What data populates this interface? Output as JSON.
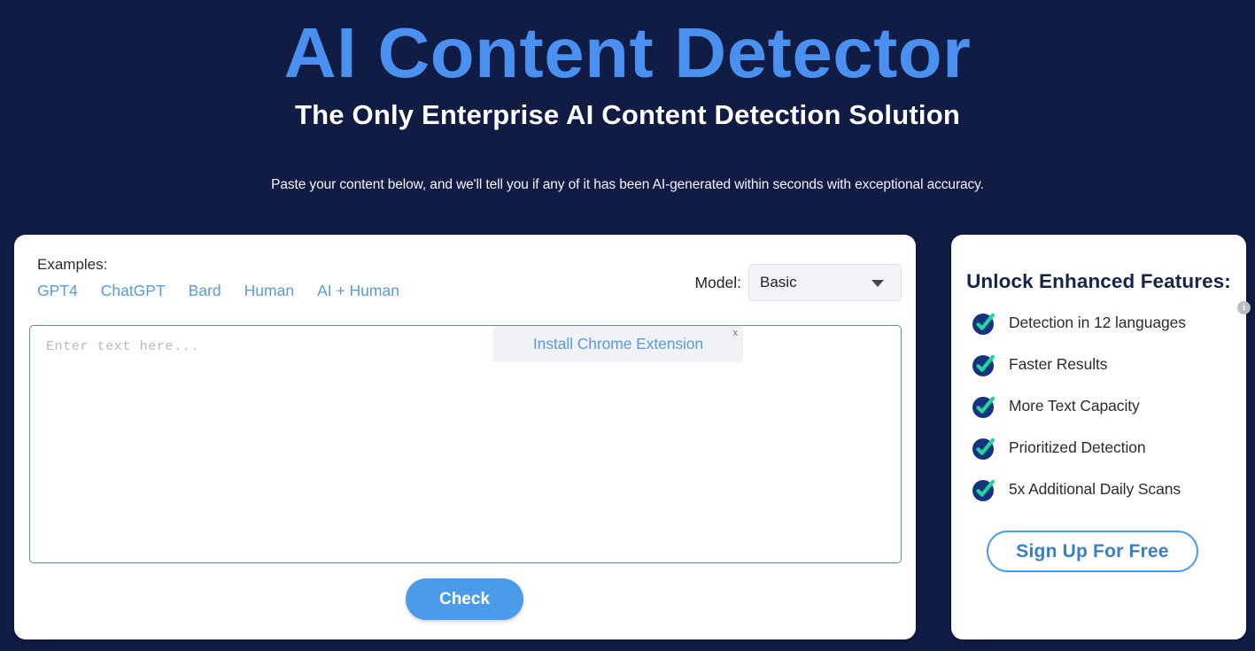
{
  "hero": {
    "title": "AI Content Detector",
    "subtitle": "The Only Enterprise AI Content Detection Solution",
    "description": "Paste your content below, and we'll tell you if any of it has been AI-generated within seconds with exceptional accuracy."
  },
  "examples": {
    "label": "Examples:",
    "links": [
      {
        "label": "GPT4"
      },
      {
        "label": "ChatGPT"
      },
      {
        "label": "Bard"
      },
      {
        "label": "Human"
      },
      {
        "label": "AI + Human"
      }
    ]
  },
  "model": {
    "label": "Model:",
    "selected": "Basic",
    "caret_icon": "chevron-down-icon"
  },
  "editor": {
    "placeholder": "Enter text here...",
    "value": ""
  },
  "extension_banner": {
    "text": "Install Chrome Extension",
    "close_label": "x",
    "close_icon": "close-icon"
  },
  "actions": {
    "check_label": "Check"
  },
  "sidebar": {
    "title": "Unlock Enhanced Features:",
    "features": [
      {
        "label": "Detection in 12 languages",
        "icon": "check-circle-icon",
        "info_badge": "i"
      },
      {
        "label": "Faster Results",
        "icon": "check-circle-icon"
      },
      {
        "label": "More Text Capacity",
        "icon": "check-circle-icon"
      },
      {
        "label": "Prioritized Detection",
        "icon": "check-circle-icon"
      },
      {
        "label": "5x Additional Daily Scans",
        "icon": "check-circle-icon"
      }
    ],
    "signup_label": "Sign Up For Free"
  },
  "colors": {
    "page_background": "#111c44",
    "title_blue": "#4a90f0",
    "link_blue": "#5b9bd5",
    "accent_blue": "#4a9bea",
    "card_white": "#ffffff",
    "check_circle_navy": "#16347e",
    "check_mark_green": "#1fd79a",
    "textarea_border": "#55939f",
    "select_background": "#f1f3f6",
    "banner_background": "#f0f2f5",
    "sidebar_title_navy": "#16244a"
  }
}
